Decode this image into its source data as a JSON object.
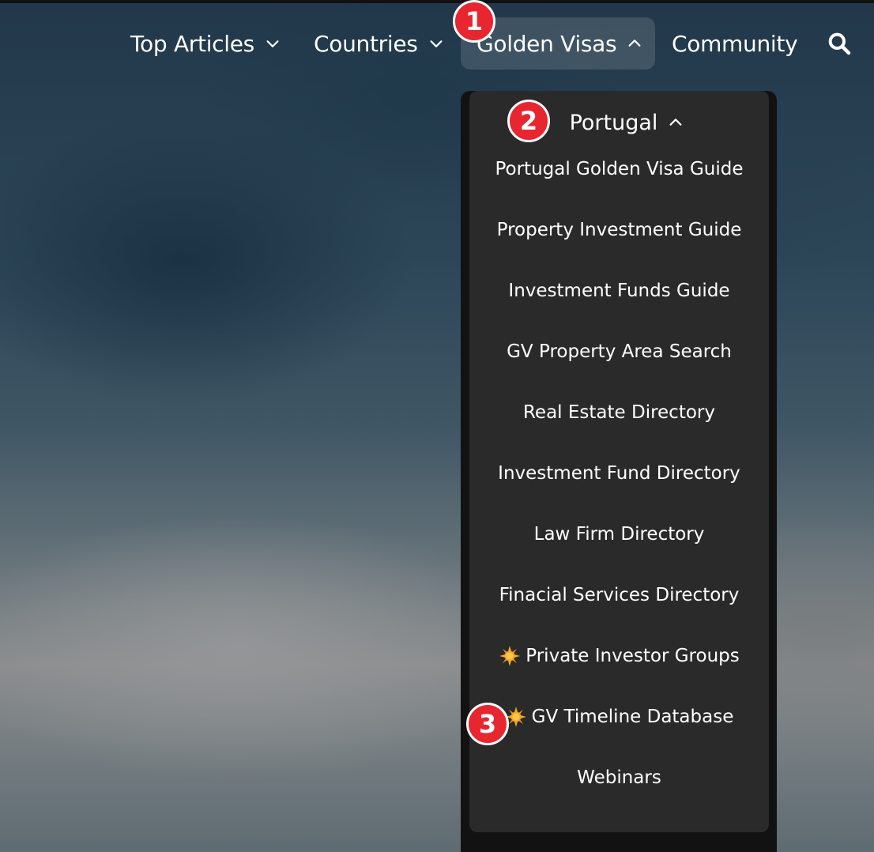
{
  "nav": {
    "items": [
      {
        "label": "Top Articles",
        "icon": "chevron-down-icon"
      },
      {
        "label": "Countries",
        "icon": "chevron-down-icon"
      },
      {
        "label": "Golden Visas",
        "icon": "chevron-up-icon",
        "active": true
      },
      {
        "label": "Community"
      }
    ],
    "search_icon": "search-icon"
  },
  "dropdown": {
    "section_label": "Portugal",
    "section_icon": "chevron-up-icon",
    "items": [
      {
        "label": "Portugal Golden Visa Guide"
      },
      {
        "label": "Property Investment Guide"
      },
      {
        "label": "Investment Funds Guide"
      },
      {
        "label": "GV Property Area Search"
      },
      {
        "label": "Real Estate Directory"
      },
      {
        "label": "Investment Fund Directory"
      },
      {
        "label": "Law Firm Directory"
      },
      {
        "label": "Finacial Services Directory"
      },
      {
        "label": "Private Investor Groups",
        "icon": "sun-icon"
      },
      {
        "label": "GV Timeline Database",
        "icon": "sun-icon"
      },
      {
        "label": "Webinars"
      }
    ]
  },
  "annotations": {
    "badges": [
      "1",
      "2",
      "3"
    ],
    "badge_color": "#e8262f"
  },
  "colors": {
    "menu_bg": "#2a2a2a",
    "text": "#ffffff",
    "sun": "#f5a623"
  }
}
